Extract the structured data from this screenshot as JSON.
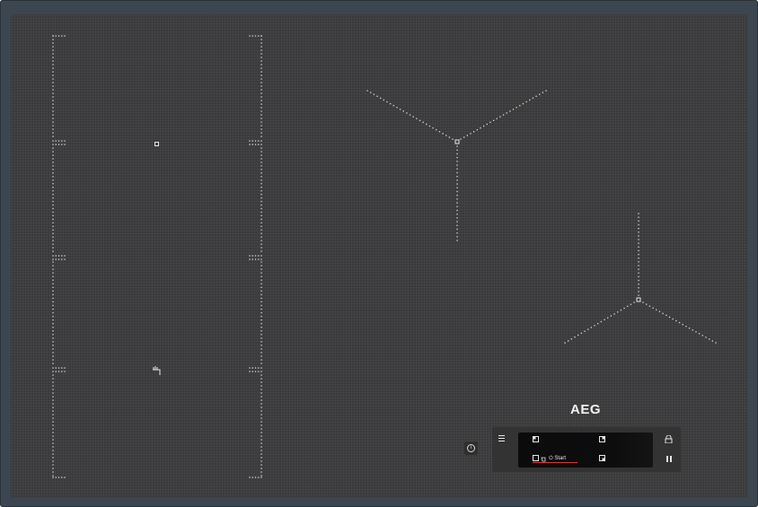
{
  "brand": {
    "logo_text": "AEG"
  },
  "controls": {
    "menu_icon": "menu-icon",
    "info_icon": "info-icon",
    "lock_icon": "lock-icon",
    "pause_icon": "pause-icon",
    "start_label": "Start",
    "start_icon": "power-icon"
  }
}
